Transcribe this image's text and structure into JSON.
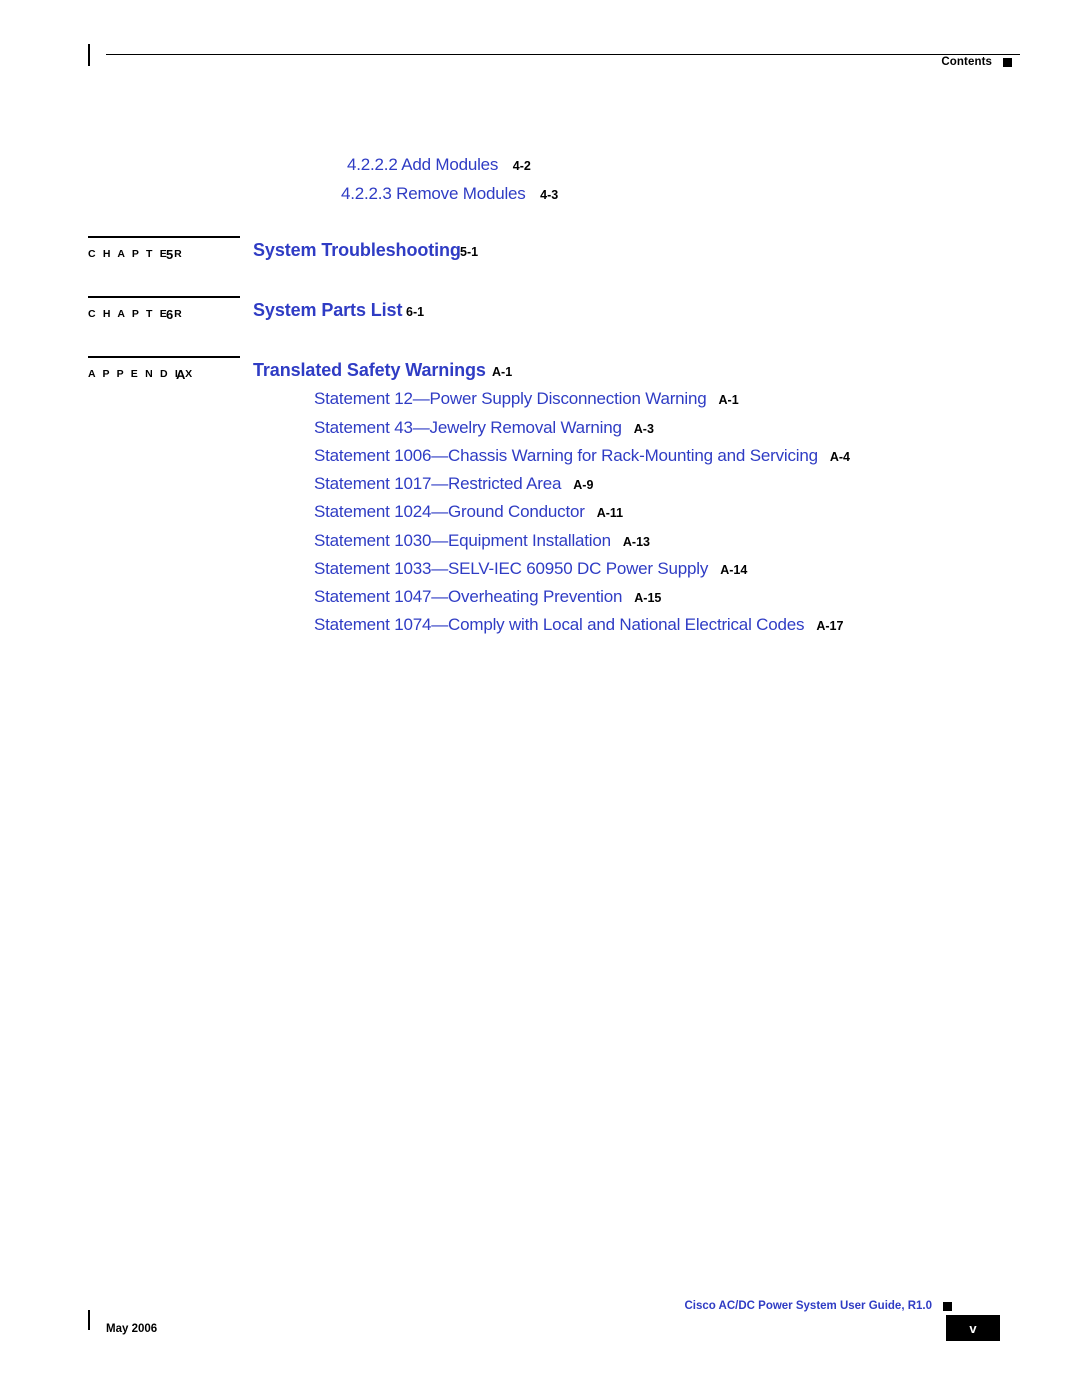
{
  "header": {
    "label": "Contents"
  },
  "toc": {
    "sub_entries": [
      {
        "num": "4.2.2.2",
        "title": "Add Modules",
        "page": "4-2"
      },
      {
        "num": "4.2.2.3",
        "title": "Remove Modules",
        "page": "4-3"
      }
    ],
    "chapters": [
      {
        "tag": "C H A P T E R",
        "tag_num": "5",
        "title": "System Troubleshooting",
        "page": "5-1"
      },
      {
        "tag": "C H A P T E R",
        "tag_num": "6",
        "title": "System Parts List",
        "page": "6-1"
      },
      {
        "tag": "A P P E N D I X",
        "tag_num": "A",
        "title": "Translated Safety Warnings",
        "page": "A-1"
      }
    ],
    "appendix_entries": [
      {
        "title": "Statement 12—Power Supply Disconnection Warning",
        "page": "A-1"
      },
      {
        "title": "Statement 43—Jewelry Removal Warning",
        "page": "A-3"
      },
      {
        "title": "Statement 1006—Chassis Warning for Rack-Mounting and Servicing",
        "page": "A-4"
      },
      {
        "title": "Statement 1017—Restricted Area",
        "page": "A-9"
      },
      {
        "title": "Statement 1024—Ground Conductor",
        "page": "A-11"
      },
      {
        "title": "Statement 1030—Equipment Installation",
        "page": "A-13"
      },
      {
        "title": "Statement 1033—SELV-IEC 60950 DC Power Supply",
        "page": "A-14"
      },
      {
        "title": "Statement 1047—Overheating Prevention",
        "page": "A-15"
      },
      {
        "title": "Statement 1074—Comply with Local and National Electrical Codes",
        "page": "A-17"
      }
    ]
  },
  "footer": {
    "date": "May 2006",
    "guide": "Cisco AC/DC Power System User Guide, R1.0",
    "page_number": "v"
  },
  "colors": {
    "link": "#2f3cc4",
    "text": "#000000"
  }
}
